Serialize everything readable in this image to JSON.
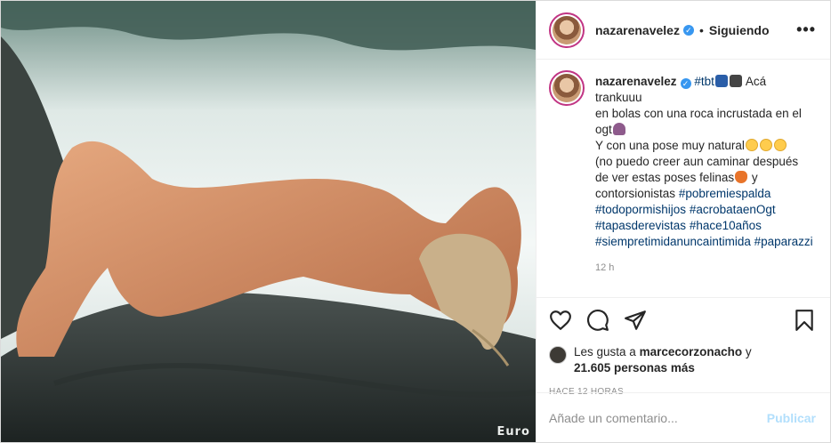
{
  "post": {
    "username": "nazarenavelez",
    "follow_label": "Siguiendo",
    "more_label": "•••",
    "image_watermark": "Euro",
    "caption": {
      "username": "nazarenavelez",
      "tag1": "#tbt",
      "line1_rest": "Acá trankuuu",
      "line2": "en bolas con una roca incrustada en el ogt",
      "line3": "Y con una pose muy natural",
      "line4": "(no puedo creer aun caminar después de ver estas poses felinas",
      "line4_end": "y contorsionistas",
      "tags": [
        "#pobremiespalda",
        "#todopormishijos",
        "#acrobataenOgt",
        "#tapasderevistas",
        "#hace10años",
        "#siempretimidanuncaintimida",
        "#paparazzi"
      ]
    },
    "time": "12 h",
    "likes": {
      "prefix": "Les gusta a",
      "user": "marcecorzonacho",
      "conj": "y",
      "count": "21.605 personas más"
    },
    "ago": "HACE 12 HORAS",
    "comment_placeholder": "Añade un comentario...",
    "publish_label": "Publicar"
  },
  "colors": {
    "link": "#00376b",
    "verified": "#3897f0",
    "publish_disabled": "#b2dffc",
    "muted": "#8e8e8e"
  },
  "icons": [
    "verified-badge-icon",
    "more-options-icon",
    "heart-icon",
    "comment-icon",
    "share-icon",
    "bookmark-icon"
  ]
}
